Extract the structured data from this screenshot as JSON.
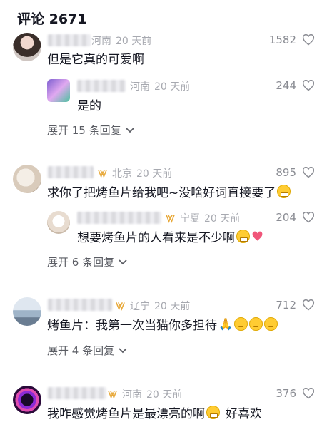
{
  "header": {
    "title": "评论 2671"
  },
  "comments": [
    {
      "location": "河南",
      "time": "20 天前",
      "likes": "1582",
      "text": "但是它真的可爱啊",
      "reply": {
        "location": "河南",
        "time": "20 天前",
        "likes": "244",
        "text": "是的"
      },
      "expand": "展开 15 条回复"
    },
    {
      "location": "北京",
      "time": "20 天前",
      "likes": "895",
      "text": "求你了把烤鱼片给我吧~没啥好词直接要了",
      "reply": {
        "location": "宁夏",
        "time": "20 天前",
        "likes": "204",
        "text": "想要烤鱼片的人看来是不少啊"
      },
      "expand": "展开 6 条回复"
    },
    {
      "location": "辽宁",
      "time": "20 天前",
      "likes": "712",
      "text": "烤鱼片：我第一次当猫你多担待",
      "expand": "展开 4 条回复"
    },
    {
      "location": "河南",
      "time": "20 天前",
      "likes": "376",
      "text": "我咋感觉烤鱼片是最漂亮的啊",
      "text_tail": "好喜欢"
    }
  ],
  "icons": {
    "heart": "heart-outline-icon",
    "badge": "gold-wings-badge-icon",
    "chevron": "chevron-down-icon"
  },
  "colors": {
    "text": "#161823",
    "meta": "#a7a9b0",
    "badge": "#e8a93a"
  }
}
